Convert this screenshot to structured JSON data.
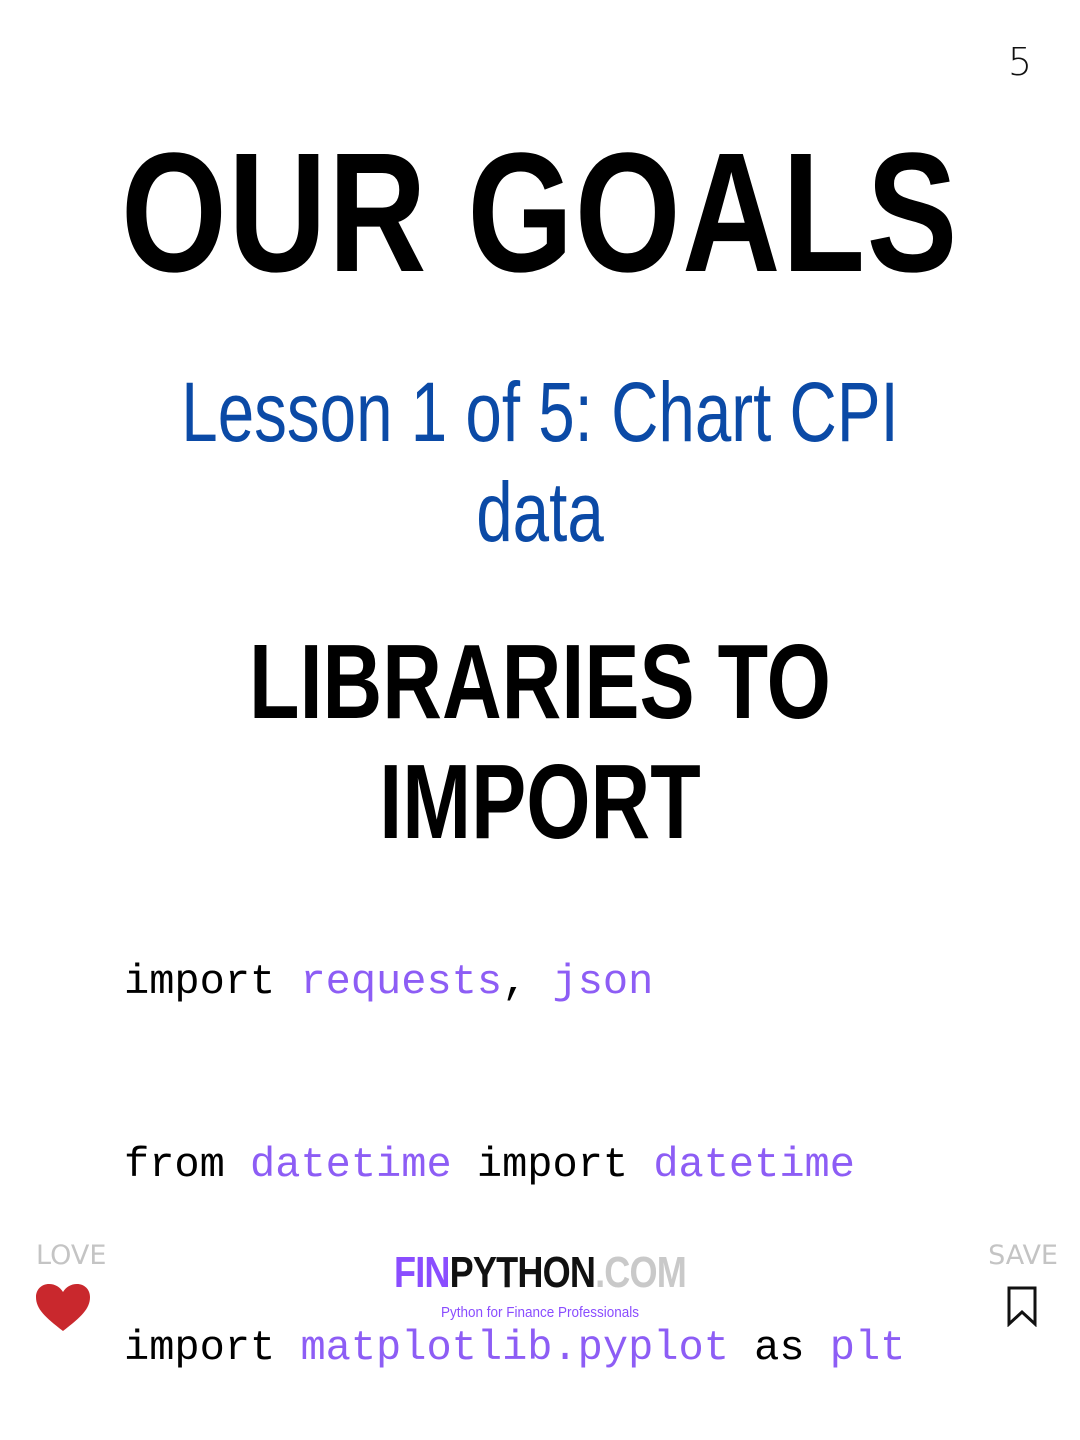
{
  "page_number": "5",
  "title": "OUR GOALS",
  "subtitle": "Lesson 1 of 5: Chart CPI data",
  "section_title": "LIBRARIES TO IMPORT",
  "code": {
    "line1": {
      "kw1": "import ",
      "mod1": "requests",
      "sep": ", ",
      "mod2": "json"
    },
    "line2": {
      "kw1": "from ",
      "mod1": "datetime",
      "kw2": " import ",
      "mod2": "datetime"
    },
    "line3": {
      "kw1": "import ",
      "mod1": "matplotlib.pyplot",
      "kw2": " as ",
      "mod2": "plt"
    }
  },
  "footer": {
    "love_label": "LOVE",
    "save_label": "SAVE",
    "brand_fin": "FIN",
    "brand_python": "PYTHON",
    "brand_com": ".COM",
    "tagline": "Python for Finance Professionals"
  },
  "colors": {
    "subtitle": "#0b4aa6",
    "code_module": "#8d5df5",
    "brand_accent": "#8a4dff",
    "heart": "#c9282d",
    "muted": "#c4c4c4"
  },
  "icons": {
    "love": "heart-icon",
    "save": "bookmark-icon"
  }
}
